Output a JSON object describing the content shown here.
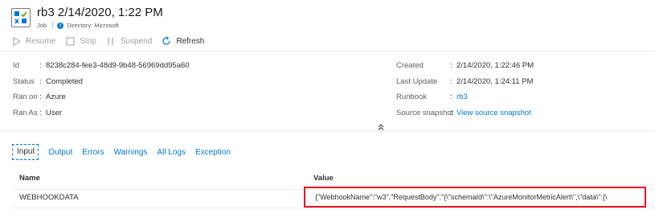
{
  "header": {
    "title": "rb3 2/14/2020, 1:22 PM",
    "type": "Job",
    "directory": "Directory: Microsoft"
  },
  "toolbar": {
    "resume": "Resume",
    "stop": "Stop",
    "suspend": "Suspend",
    "refresh": "Refresh"
  },
  "props_left": [
    {
      "label": "Id",
      "value": "8238c284-fee3-48d9-9b48-56969dd95a60"
    },
    {
      "label": "Status",
      "value": "Completed"
    },
    {
      "label": "Ran on",
      "value": "Azure"
    },
    {
      "label": "Ran As",
      "value": "User"
    }
  ],
  "props_right": [
    {
      "label": "Created",
      "value": "2/14/2020, 1:22:46 PM"
    },
    {
      "label": "Last Update",
      "value": "2/14/2020, 1:24:11 PM"
    },
    {
      "label": "Runbook",
      "value": "rb3"
    },
    {
      "label": "Source snapshot",
      "value": "View source snapshot"
    }
  ],
  "tabs": [
    "Input",
    "Output",
    "Errors",
    "Warnings",
    "All Logs",
    "Exception"
  ],
  "table": {
    "headers": [
      "Name",
      "Value"
    ],
    "rows": [
      {
        "name": "WEBHOOKDATA",
        "value": "{\"WebhookName\":\"w3\",\"RequestBody\":\"{\\\"schemaId\\\":\\\"AzureMonitorMetricAlert\\\",\\\"data\\\":{\\"
      }
    ]
  },
  "colors": {
    "accent": "#0078d4",
    "highlight_border": "#e81123"
  }
}
